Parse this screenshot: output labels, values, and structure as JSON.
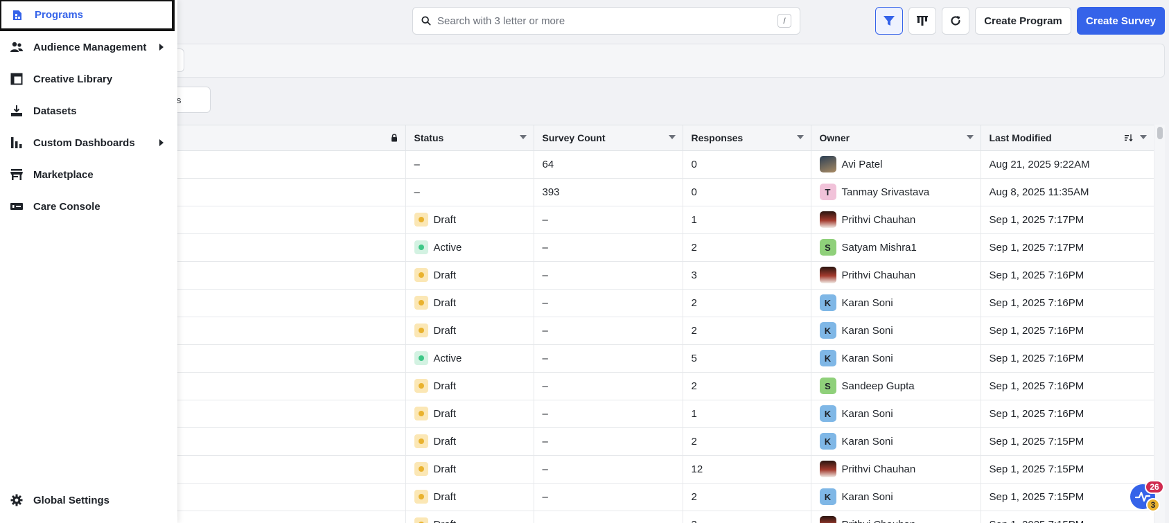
{
  "search": {
    "placeholder": "Search with 3 letter or more",
    "shortcut": "/"
  },
  "toolbar": {
    "filter_icon": "filter-icon",
    "columns_icon": "columns-icon",
    "refresh_icon": "refresh-icon",
    "create_program_label": "Create Program",
    "create_survey_label": "Create Survey",
    "accent": "#3563e9"
  },
  "filters": {
    "more_label": "·",
    "view_label": "tes"
  },
  "table": {
    "columns": [
      "",
      "Status",
      "Survey Count",
      "Responses",
      "Owner",
      "Last Modified"
    ],
    "rows": [
      {
        "status": "–",
        "survey_count": "64",
        "responses": "0",
        "owner": "Avi Patel",
        "owner_initial": "",
        "avatar": "photo-dark",
        "last_modified": "Aug 21, 2025 9:22AM"
      },
      {
        "status": "–",
        "survey_count": "393",
        "responses": "0",
        "owner": "Tanmay Srivastava",
        "owner_initial": "T",
        "avatar": "pink",
        "last_modified": "Aug 8, 2025 11:35AM"
      },
      {
        "status": "Draft",
        "survey_count": "–",
        "responses": "1",
        "owner": "Prithvi Chauhan",
        "owner_initial": "",
        "avatar": "photo-red",
        "last_modified": "Sep 1, 2025 7:17PM"
      },
      {
        "status": "Active",
        "survey_count": "–",
        "responses": "2",
        "owner": "Satyam Mishra1",
        "owner_initial": "S",
        "avatar": "green",
        "last_modified": "Sep 1, 2025 7:17PM"
      },
      {
        "status": "Draft",
        "survey_count": "–",
        "responses": "3",
        "owner": "Prithvi Chauhan",
        "owner_initial": "",
        "avatar": "photo-red",
        "last_modified": "Sep 1, 2025 7:16PM"
      },
      {
        "status": "Draft",
        "survey_count": "–",
        "responses": "2",
        "owner": "Karan Soni",
        "owner_initial": "K",
        "avatar": "blue",
        "last_modified": "Sep 1, 2025 7:16PM"
      },
      {
        "status": "Draft",
        "survey_count": "–",
        "responses": "2",
        "owner": "Karan Soni",
        "owner_initial": "K",
        "avatar": "blue",
        "last_modified": "Sep 1, 2025 7:16PM"
      },
      {
        "status": "Active",
        "survey_count": "–",
        "responses": "5",
        "owner": "Karan Soni",
        "owner_initial": "K",
        "avatar": "blue",
        "last_modified": "Sep 1, 2025 7:16PM"
      },
      {
        "status": "Draft",
        "survey_count": "–",
        "responses": "2",
        "owner": "Sandeep Gupta",
        "owner_initial": "S",
        "avatar": "green",
        "last_modified": "Sep 1, 2025 7:16PM"
      },
      {
        "status": "Draft",
        "survey_count": "–",
        "responses": "1",
        "owner": "Karan Soni",
        "owner_initial": "K",
        "avatar": "blue",
        "last_modified": "Sep 1, 2025 7:16PM"
      },
      {
        "status": "Draft",
        "survey_count": "–",
        "responses": "2",
        "owner": "Karan Soni",
        "owner_initial": "K",
        "avatar": "blue",
        "last_modified": "Sep 1, 2025 7:15PM"
      },
      {
        "status": "Draft",
        "survey_count": "–",
        "responses": "12",
        "owner": "Prithvi Chauhan",
        "owner_initial": "",
        "avatar": "photo-red",
        "last_modified": "Sep 1, 2025 7:15PM"
      },
      {
        "status": "Draft",
        "survey_count": "–",
        "responses": "2",
        "owner": "Karan Soni",
        "owner_initial": "K",
        "avatar": "blue",
        "last_modified": "Sep 1, 2025 7:15PM"
      },
      {
        "status": "Draft",
        "survey_count": "–",
        "responses": "3",
        "owner": "Prithvi Chauhan",
        "owner_initial": "",
        "avatar": "photo-red",
        "last_modified": "Sep 1, 2025 7:15PM"
      }
    ]
  },
  "sidebar": {
    "items": [
      {
        "label": "Programs",
        "icon": "programs-icon",
        "selected": true,
        "has_submenu": false
      },
      {
        "label": "Audience Management",
        "icon": "audience-icon",
        "selected": false,
        "has_submenu": true
      },
      {
        "label": "Creative Library",
        "icon": "creative-library-icon",
        "selected": false,
        "has_submenu": false
      },
      {
        "label": "Datasets",
        "icon": "datasets-icon",
        "selected": false,
        "has_submenu": false
      },
      {
        "label": "Custom Dashboards",
        "icon": "dashboards-icon",
        "selected": false,
        "has_submenu": true
      },
      {
        "label": "Marketplace",
        "icon": "marketplace-icon",
        "selected": false,
        "has_submenu": false
      },
      {
        "label": "Care Console",
        "icon": "care-console-icon",
        "selected": false,
        "has_submenu": false
      }
    ],
    "footer": {
      "label": "Global Settings",
      "icon": "gear-icon"
    }
  },
  "help_widget": {
    "icon": "activity-icon",
    "notifications": "26",
    "alerts": "3"
  }
}
